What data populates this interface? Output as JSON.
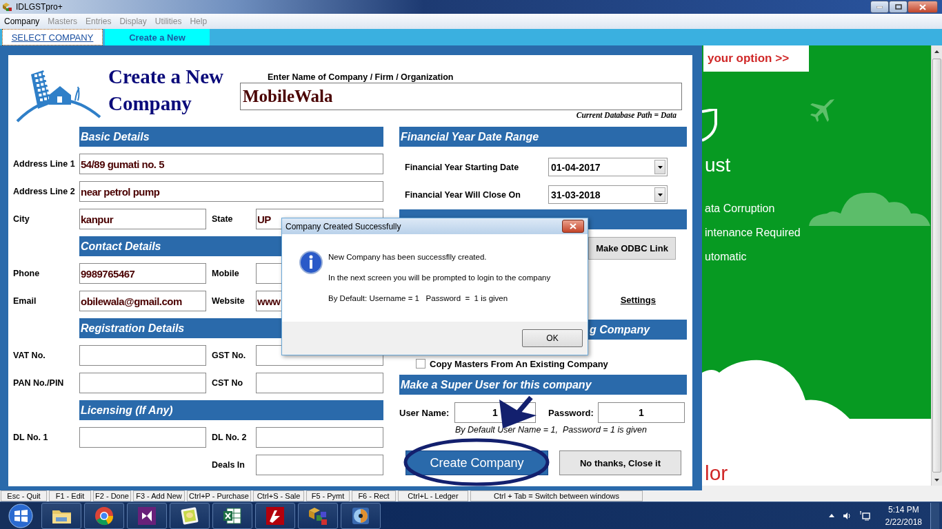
{
  "window": {
    "title": "IDLGSTpro+"
  },
  "menu": [
    {
      "label": "Company",
      "disabled": false
    },
    {
      "label": "Masters",
      "disabled": true
    },
    {
      "label": "Entries",
      "disabled": true
    },
    {
      "label": "Display",
      "disabled": true
    },
    {
      "label": "Utilities",
      "disabled": true
    },
    {
      "label": "Help",
      "disabled": true
    }
  ],
  "tabs": [
    {
      "label": "SELECT COMPANY",
      "selected": false
    },
    {
      "label": "Create a New",
      "selected": true
    }
  ],
  "form": {
    "title_lines": [
      "Create a New",
      "Company"
    ],
    "name_label": "Enter Name of Company / Firm / Organization",
    "name_value": "MobileWala",
    "db_path": "Current Database Path = Data"
  },
  "left_sections": [
    {
      "heading": "Basic Details",
      "rows": [
        {
          "kind": "full",
          "fields": [
            {
              "label": "Address Line 1",
              "value": "54/89 gumati no. 5"
            }
          ]
        },
        {
          "kind": "full",
          "fields": [
            {
              "label": "Address Line 2",
              "value": "near petrol pump"
            }
          ]
        },
        {
          "kind": "pair",
          "fields": [
            {
              "label": "City",
              "value": "kanpur"
            },
            {
              "label": "State",
              "value": "UP"
            }
          ]
        }
      ]
    },
    {
      "heading": "Contact Details",
      "rows": [
        {
          "kind": "pair",
          "fields": [
            {
              "label": "Phone",
              "value": "9989765467"
            },
            {
              "label": "Mobile"
            }
          ]
        },
        {
          "kind": "pair",
          "fields": [
            {
              "label": "Email",
              "value": "obilewala@gmail.com"
            },
            {
              "label": "Website",
              "value": "www"
            }
          ]
        }
      ]
    },
    {
      "heading": "Registration Details",
      "rows": [
        {
          "kind": "pair",
          "fields": [
            {
              "label": "VAT No."
            },
            {
              "label": "GST No."
            }
          ]
        },
        {
          "kind": "pair",
          "fields": [
            {
              "label": "PAN No./PIN"
            },
            {
              "label": "CST No"
            }
          ]
        }
      ]
    },
    {
      "heading": "Licensing (If Any)",
      "rows": [
        {
          "kind": "pair",
          "fields": [
            {
              "label": "DL No. 1"
            },
            {
              "label": "DL No. 2"
            }
          ]
        },
        {
          "kind": "right",
          "fields": [
            {
              "label": "Deals In"
            }
          ]
        }
      ]
    }
  ],
  "financial_year": {
    "heading": "Financial Year Date Range",
    "rows": [
      {
        "label": "Financial Year Starting Date",
        "value": "01-04-2017"
      },
      {
        "label": "Financial Year Will Close On",
        "value": "31-03-2018"
      }
    ]
  },
  "database_options": {
    "odbc_button": "Make ODBC Link",
    "settings_link": "Settings"
  },
  "copy_section": {
    "heading": "g Company",
    "checkbox": {
      "label": "Copy Masters From An Existing Company",
      "checked": false
    }
  },
  "super_user": {
    "heading": "Make a Super User for this company",
    "fields": [
      {
        "label": "User Name:",
        "value": "1"
      },
      {
        "label": "Password:",
        "value": "1"
      }
    ],
    "hint": "By Default User Name = 1,  Password = 1 is given"
  },
  "buttons": [
    {
      "label": "Create Company",
      "kind": "primary"
    },
    {
      "label": "No thanks, Close it",
      "kind": "secondary"
    }
  ],
  "dialog": {
    "title": "Company Created Successfully",
    "lines": [
      "New Company has been successflly created.",
      "In the next screen you will be prompted to login to the company",
      "By Default: Username = 1   Password  =  1 is given"
    ],
    "button": "OK"
  },
  "ad": {
    "tag": "your option >>",
    "headline": "ust",
    "features": [
      "ata Corruption",
      "intenance Required",
      "utomatic"
    ],
    "footer": "lor"
  },
  "status_bar": [
    "Esc - Quit",
    "F1 - Edit",
    "F2 - Done",
    "F3 - Add New",
    "Ctrl+P - Purchase",
    "Ctrl+S - Sale",
    "F5 - Pymt",
    "F6 - Rect",
    "Ctrl+L - Ledger",
    "Ctrl + Tab = Switch between windows"
  ],
  "taskbar": {
    "time": "5:14 PM",
    "date": "2/22/2018"
  }
}
